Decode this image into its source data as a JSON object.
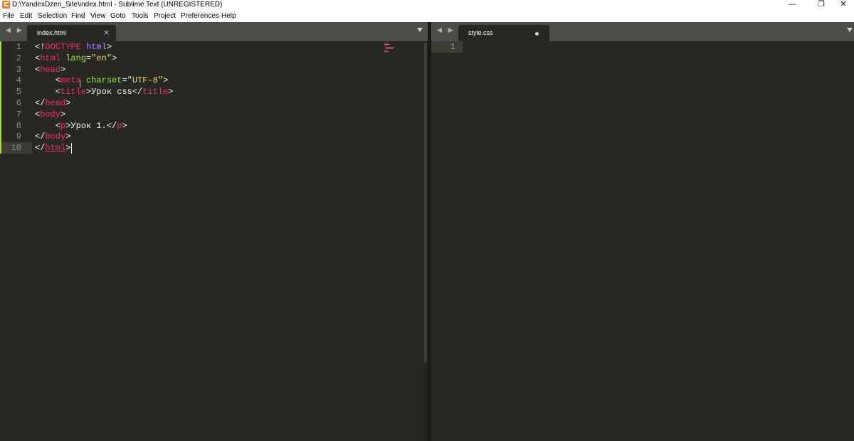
{
  "window": {
    "title": "D:\\YandexDzen_Site\\index.html - Sublime Text (UNREGISTERED)",
    "controls": {
      "minimize": "—",
      "restore": "❐",
      "close": "✕"
    }
  },
  "menu": [
    "File",
    "Edit",
    "Selection",
    "Find",
    "View",
    "Goto",
    "Tools",
    "Project",
    "Preferences",
    "Help"
  ],
  "left_group": {
    "nav": "◀ ▶",
    "tab": {
      "label": "index.html",
      "close": "×"
    },
    "dropdown": "▼",
    "lines": [
      {
        "n": "1",
        "tokens": [
          [
            "br",
            "<!"
          ],
          [
            "doc",
            "DOCTYPE"
          ],
          [
            "br",
            " "
          ],
          [
            "docn",
            "html"
          ],
          [
            "br",
            ">"
          ]
        ]
      },
      {
        "n": "2",
        "tokens": [
          [
            "br",
            "<"
          ],
          [
            "tag",
            "html"
          ],
          [
            "br",
            " "
          ],
          [
            "attr",
            "lang"
          ],
          [
            "br",
            "="
          ],
          [
            "str",
            "\"en\""
          ],
          [
            "br",
            ">"
          ]
        ]
      },
      {
        "n": "3",
        "tokens": [
          [
            "br",
            "<"
          ],
          [
            "tag",
            "head"
          ],
          [
            "br",
            ">"
          ]
        ]
      },
      {
        "n": "4",
        "tokens": [
          [
            "br",
            "    <"
          ],
          [
            "tag",
            "meta"
          ],
          [
            "br",
            " "
          ],
          [
            "attr",
            "charset"
          ],
          [
            "br",
            "="
          ],
          [
            "str",
            "\"UTF-8\""
          ],
          [
            "br",
            ">"
          ]
        ]
      },
      {
        "n": "5",
        "tokens": [
          [
            "br",
            "    <"
          ],
          [
            "tag",
            "title"
          ],
          [
            "br",
            ">"
          ],
          [
            "txt",
            "Урок css"
          ],
          [
            "br",
            "</"
          ],
          [
            "tag",
            "title"
          ],
          [
            "br",
            ">"
          ]
        ]
      },
      {
        "n": "6",
        "tokens": [
          [
            "br",
            "</"
          ],
          [
            "tag",
            "head"
          ],
          [
            "br",
            ">"
          ]
        ]
      },
      {
        "n": "7",
        "tokens": [
          [
            "br",
            "<"
          ],
          [
            "tag",
            "body"
          ],
          [
            "br",
            ">"
          ]
        ]
      },
      {
        "n": "8",
        "tokens": [
          [
            "br",
            "    <"
          ],
          [
            "tag",
            "p"
          ],
          [
            "br",
            ">"
          ],
          [
            "txt",
            "Урок 1."
          ],
          [
            "br",
            "</"
          ],
          [
            "tag",
            "p"
          ],
          [
            "br",
            ">"
          ]
        ]
      },
      {
        "n": "9",
        "tokens": [
          [
            "br",
            "</"
          ],
          [
            "tag",
            "body"
          ],
          [
            "br",
            ">"
          ]
        ]
      },
      {
        "n": "10",
        "tokens": [
          [
            "br",
            "</"
          ],
          [
            "tagul",
            "html"
          ],
          [
            "br",
            ">"
          ]
        ]
      }
    ]
  },
  "right_group": {
    "nav": "◀ ▶",
    "tab": {
      "label": "style.css",
      "modified": true
    },
    "dropdown": "▼",
    "lines": [
      {
        "n": "1"
      }
    ]
  },
  "theme": {
    "background": "#272822",
    "tag": "#f92672",
    "attribute": "#a6e22e",
    "string": "#e6db74",
    "doctype_name": "#ae81ff",
    "text": "#f8f8f2",
    "line_number": "#90908a",
    "tab_bar": "#4d4d4a"
  }
}
